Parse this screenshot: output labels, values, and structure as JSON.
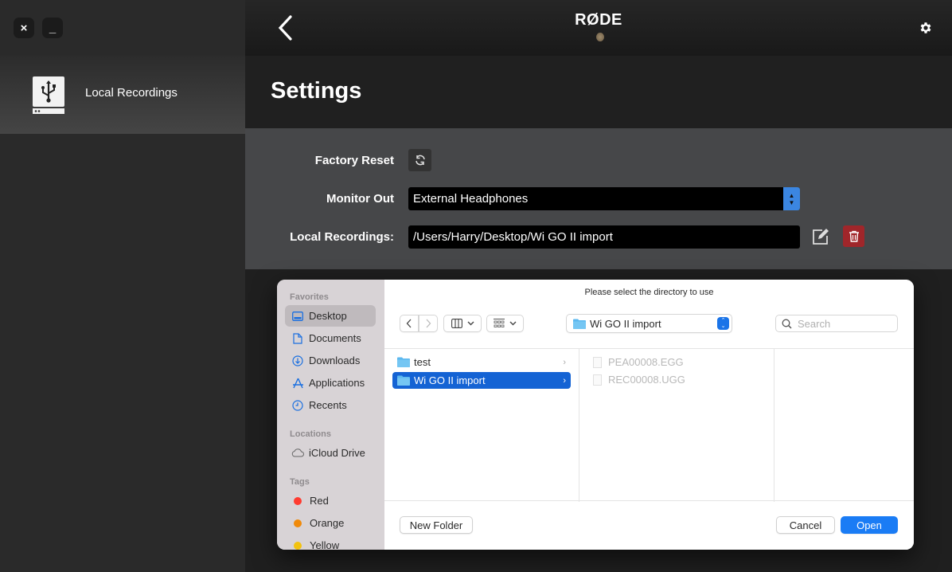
{
  "window": {
    "close_label": "×",
    "minimize_label": "_"
  },
  "sidebar": {
    "items": [
      {
        "label": "Local Recordings",
        "icon": "usb-drive-icon",
        "active": true
      }
    ]
  },
  "header": {
    "back_icon": "chevron-left-icon",
    "logo": "RØDE",
    "settings_icon": "gear-icon"
  },
  "page": {
    "title": "Settings"
  },
  "settings": {
    "factory_reset": {
      "label": "Factory Reset",
      "icon": "refresh-icon"
    },
    "monitor_out": {
      "label": "Monitor Out",
      "value": "External Headphones"
    },
    "local_recordings": {
      "label": "Local Recordings:",
      "value": "/Users/Harry/Desktop/Wi GO II import",
      "edit_icon": "edit-icon",
      "delete_icon": "trash-icon"
    }
  },
  "dialog": {
    "prompt": "Please select the directory to use",
    "sidebar": {
      "favorites_header": "Favorites",
      "favorites": [
        {
          "label": "Desktop",
          "icon": "desktop-icon",
          "active": true
        },
        {
          "label": "Documents",
          "icon": "document-icon"
        },
        {
          "label": "Downloads",
          "icon": "download-icon"
        },
        {
          "label": "Applications",
          "icon": "applications-icon"
        },
        {
          "label": "Recents",
          "icon": "clock-icon"
        }
      ],
      "locations_header": "Locations",
      "locations": [
        {
          "label": "iCloud Drive",
          "icon": "cloud-icon"
        }
      ],
      "tags_header": "Tags",
      "tags": [
        {
          "label": "Red",
          "color": "#ff3b30"
        },
        {
          "label": "Orange",
          "color": "#f08a0a"
        },
        {
          "label": "Yellow",
          "color": "#f2c20f"
        }
      ]
    },
    "toolbar": {
      "back_label": "‹",
      "forward_label": "›",
      "location": "Wi GO II import",
      "search_placeholder": "Search"
    },
    "columns": {
      "first": [
        {
          "name": "test",
          "type": "folder",
          "selected": false
        },
        {
          "name": "Wi GO II import",
          "type": "folder",
          "selected": true
        }
      ],
      "second": [
        {
          "name": "PEA00008.EGG",
          "type": "file",
          "disabled": true
        },
        {
          "name": "REC00008.UGG",
          "type": "file",
          "disabled": true
        }
      ]
    },
    "buttons": {
      "new_folder": "New Folder",
      "cancel": "Cancel",
      "open": "Open"
    },
    "accent_color": "#1a7cf5"
  }
}
